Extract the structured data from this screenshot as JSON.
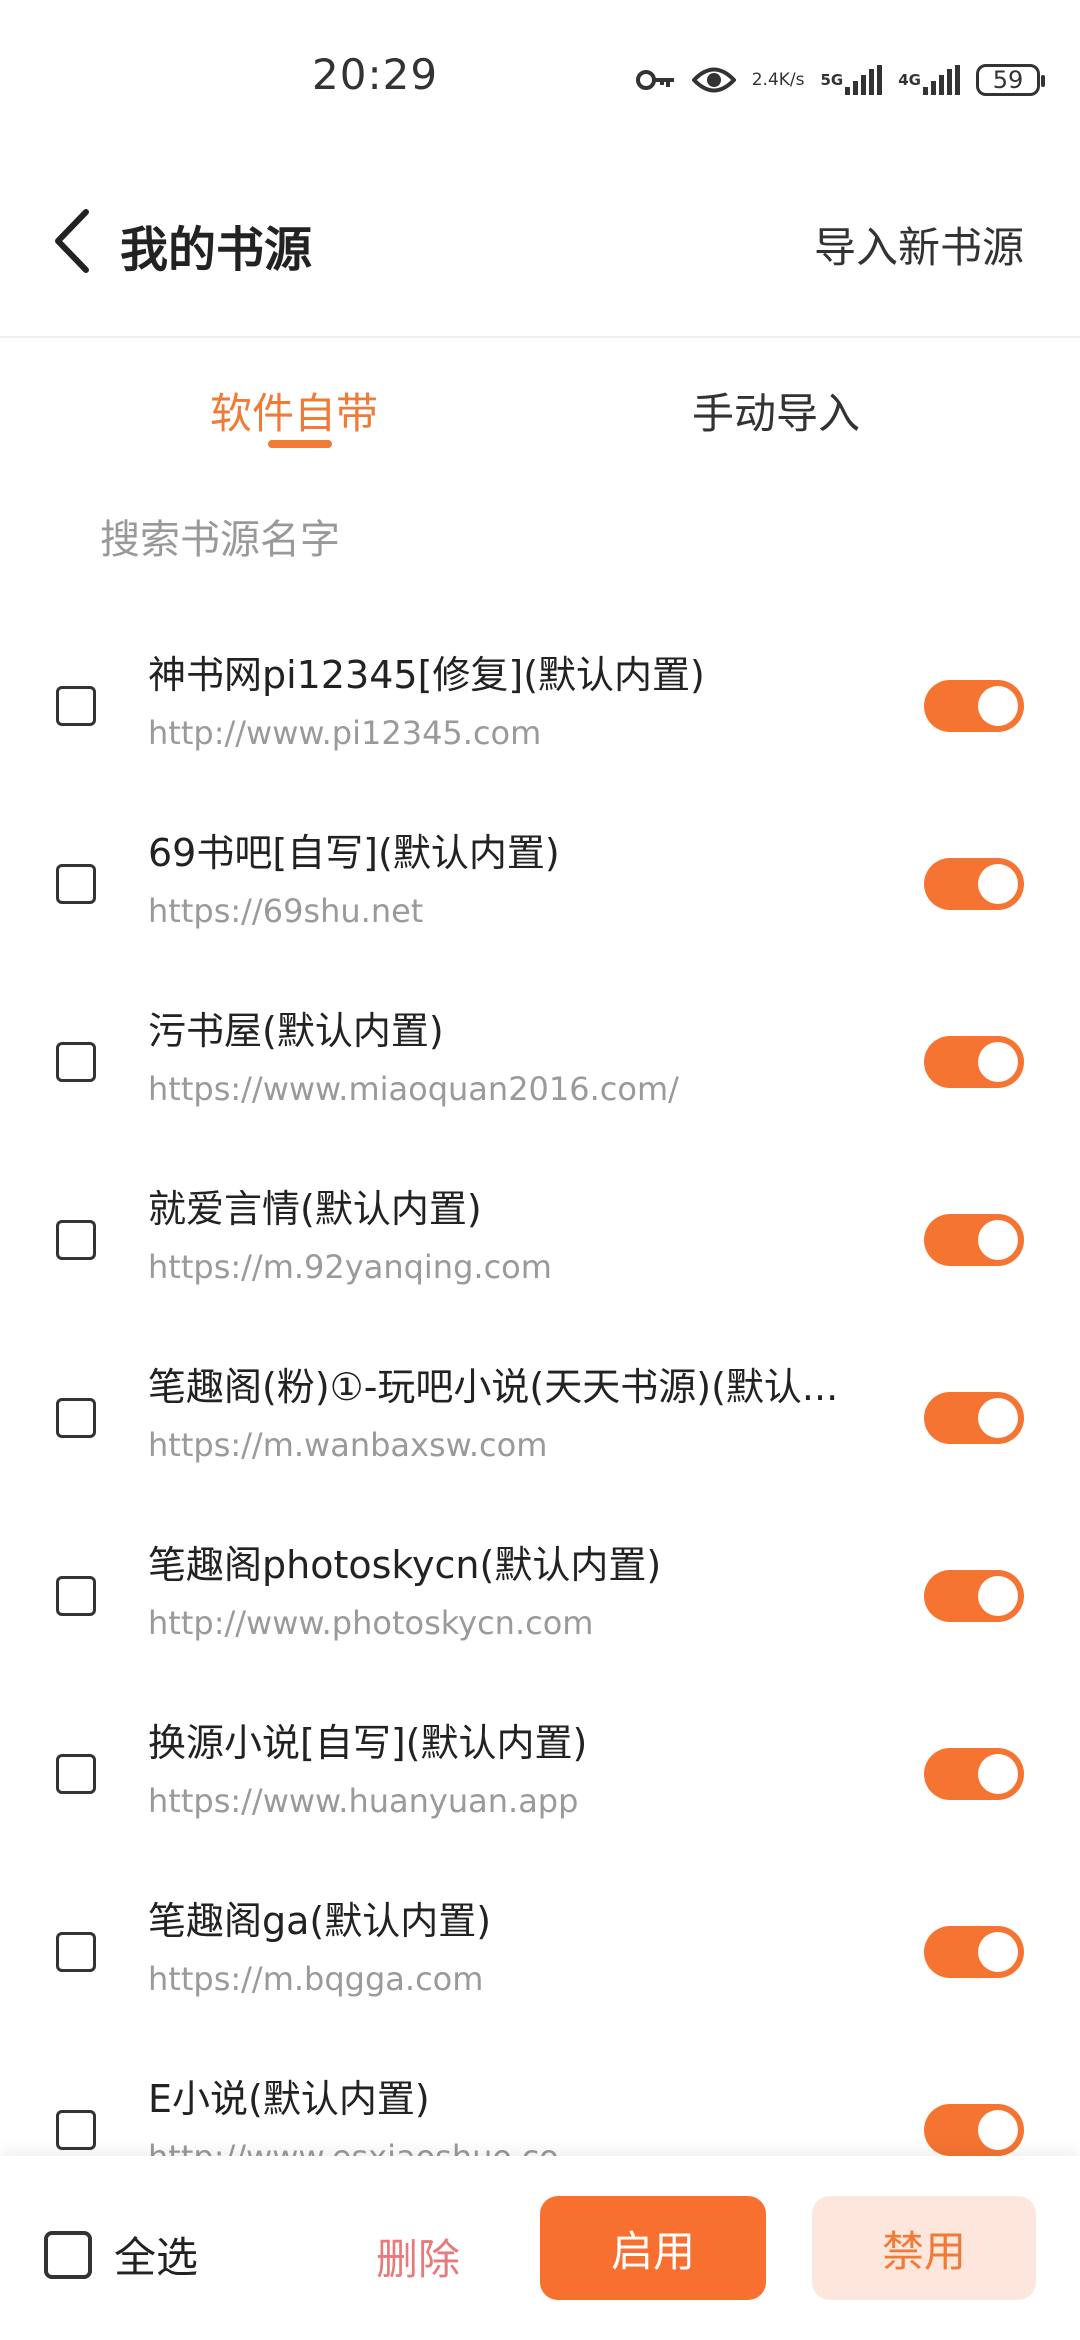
{
  "status_bar": {
    "time": "20:29",
    "speed_value": "2.4",
    "speed_unit": "K/s",
    "network_1": "5G",
    "network_2": "4G",
    "battery": "59"
  },
  "header": {
    "title": "我的书源",
    "import_label": "导入新书源"
  },
  "tabs": [
    {
      "label": "软件自带",
      "active": true
    },
    {
      "label": "手动导入",
      "active": false
    }
  ],
  "search": {
    "placeholder": "搜索书源名字",
    "value": ""
  },
  "sources": [
    {
      "name": "神书网pi12345[修复](默认内置)",
      "url": "http://www.pi12345.com",
      "enabled": true,
      "checked": false
    },
    {
      "name": "69书吧[自写](默认内置)",
      "url": "https://69shu.net",
      "enabled": true,
      "checked": false
    },
    {
      "name": "污书屋(默认内置)",
      "url": "https://www.miaoquan2016.com/",
      "enabled": true,
      "checked": false
    },
    {
      "name": "就爱言情(默认内置)",
      "url": "https://m.92yanqing.com",
      "enabled": true,
      "checked": false
    },
    {
      "name": "笔趣阁(粉)①-玩吧小说(天天书源)(默认...",
      "url": "https://m.wanbaxsw.com",
      "enabled": true,
      "checked": false
    },
    {
      "name": "笔趣阁photoskycn(默认内置)",
      "url": "http://www.photoskycn.com",
      "enabled": true,
      "checked": false
    },
    {
      "name": "换源小说[自写](默认内置)",
      "url": "https://www.huanyuan.app",
      "enabled": true,
      "checked": false
    },
    {
      "name": "笔趣阁ga(默认内置)",
      "url": "https://m.bqgga.com",
      "enabled": true,
      "checked": false
    },
    {
      "name": "E小说(默认内置)",
      "url": "http://www.esxiaoshuo.co",
      "enabled": true,
      "checked": false
    }
  ],
  "bottom_bar": {
    "select_all_label": "全选",
    "delete_label": "删除",
    "enable_label": "启用",
    "disable_label": "禁用"
  },
  "colors": {
    "accent": "#f57431",
    "disable_bg": "#fde7dc",
    "delete_text": "#e77a7a"
  }
}
